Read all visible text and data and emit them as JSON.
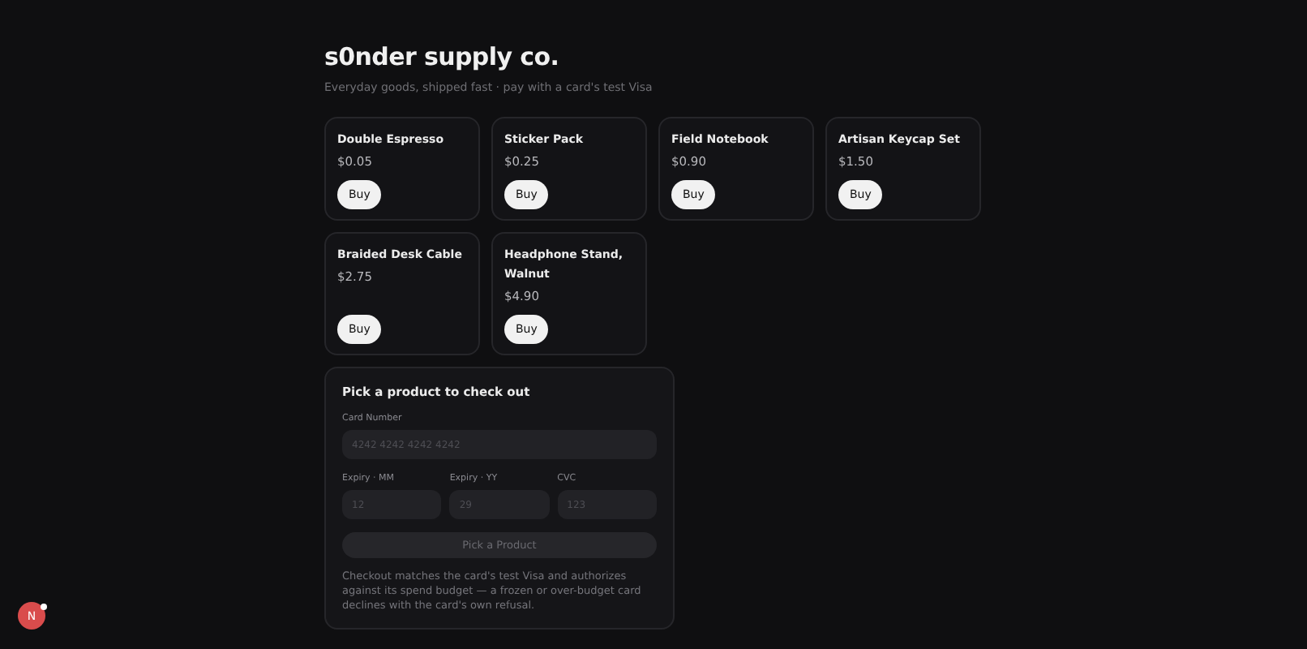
{
  "header": {
    "title": "s0nder supply co.",
    "subtitle": "Everyday goods, shipped fast · pay with a card's test Visa"
  },
  "products": [
    {
      "name": "Double Espresso",
      "price": "$0.05",
      "button": "Buy"
    },
    {
      "name": "Sticker Pack",
      "price": "$0.25",
      "button": "Buy"
    },
    {
      "name": "Field Notebook",
      "price": "$0.90",
      "button": "Buy"
    },
    {
      "name": "Artisan Keycap Set",
      "price": "$1.50",
      "button": "Buy"
    },
    {
      "name": "Braided Desk Cable",
      "price": "$2.75",
      "button": "Buy"
    },
    {
      "name": "Headphone Stand, Walnut",
      "price": "$4.90",
      "button": "Buy"
    }
  ],
  "checkout": {
    "title": "Pick a product to check out",
    "card_number": {
      "label": "Card Number",
      "placeholder": "4242 4242 4242 4242"
    },
    "fields": [
      {
        "label": "Expiry · MM",
        "placeholder": "12"
      },
      {
        "label": "Expiry · YY",
        "placeholder": "29"
      },
      {
        "label": "CVC",
        "placeholder": "123"
      }
    ],
    "submit": {
      "label": "Pick a Product",
      "disabled": true
    },
    "note": "Checkout matches the card's test Visa and authorizes against its spend budget — a frozen or over-budget card declines with the card's own refusal."
  },
  "dev_badge": {
    "letter": "N"
  }
}
